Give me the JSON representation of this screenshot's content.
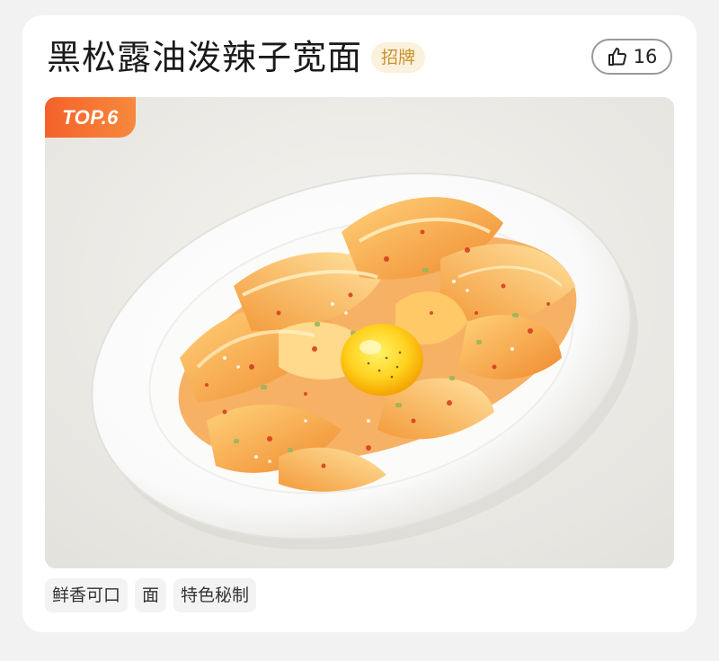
{
  "dish": {
    "name": "黑松露油泼辣子宽面",
    "signature_badge": "招牌",
    "rank_badge": "TOP.6",
    "likes": {
      "count": "16",
      "icon": "thumbs-up-icon"
    },
    "photo": {
      "subject": "food-photo"
    },
    "tags": [
      "鲜香可口",
      "面",
      "特色秘制"
    ]
  },
  "colors": {
    "rank_badge_start": "#f4622a",
    "rank_badge_end": "#f7893d",
    "signature_badge_text": "#c9922f",
    "signature_badge_bg": "#fbf1dc",
    "tag_bg": "#f3f3f3",
    "card_bg": "#ffffff",
    "page_bg": "#f2f2f2"
  }
}
